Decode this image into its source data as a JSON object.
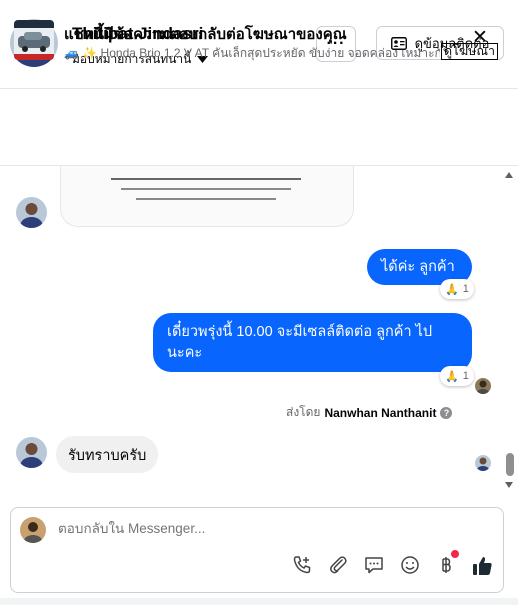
{
  "header": {
    "contact_name": "Thitipat Jindasri",
    "assign_label": "มอบหมายการสนทนานี้",
    "more_label": "···",
    "view_contact_label": "ดูข้อมูลติดต่อ"
  },
  "ad_banner": {
    "title": "แชทนี้มีข้อความตอบกลับต่อโฆษณาของคุณ",
    "subtitle": "🚙 ✨ Honda Brio 1.2 V AT คันเล็กสุดประหยัด ขับง่าย จอดคล่อง เหมาะกั...",
    "view_ad_label": "ดูโฆษณา",
    "close_label": "✕"
  },
  "messages": {
    "outgoing_1": {
      "text": "ได้ค่ะ  ลูกค้า",
      "reaction_emoji": "🙏",
      "reaction_count": "1"
    },
    "outgoing_2": {
      "text": "เดี๋ยวพรุ่งนี้ 10.00 จะมีเซลล์ติดต่อ ลูกค้า  ไป นะคะ",
      "reaction_emoji": "🙏",
      "reaction_count": "1"
    },
    "sent_by_prefix": "ส่งโดย",
    "sent_by_name": "Nanwhan Nanthanit",
    "help_icon_label": "?",
    "incoming_1": {
      "text": "รับทราบครับ"
    }
  },
  "composer": {
    "placeholder": "ตอบกลับใน Messenger..."
  },
  "colors": {
    "accent": "#0866ff",
    "incoming_bubble": "#f0f0f0",
    "secondary_text": "#65676b",
    "notification_dot": "#f02849"
  },
  "icons": {
    "more": "ellipsis-icon",
    "contact_card": "contact-card-icon",
    "dropdown": "caret-down-icon",
    "call": "phone-add-icon",
    "attach": "paperclip-icon",
    "saved_replies": "chat-bubble-icon",
    "emoji": "smiley-icon",
    "payment": "baht-icon",
    "like": "thumbs-up-icon"
  }
}
